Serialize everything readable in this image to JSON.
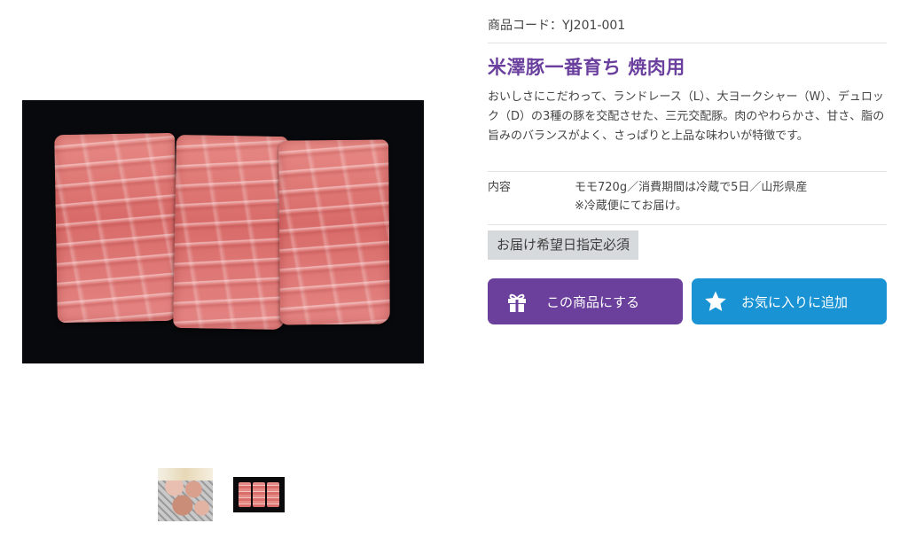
{
  "gallery": {
    "main_image_alt": "",
    "thumbnails": [
      {
        "name": "thumbnail-package"
      },
      {
        "name": "thumbnail-meat"
      }
    ]
  },
  "product": {
    "code": "商品コード：YJ201-001",
    "title": "米澤豚一番育ち 焼肉用",
    "description": "おいしさにこだわって、ランドレース（L）、大ヨークシャー（W）、デュロック（D）の3種の豚を交配させた、三元交配豚。肉のやわらかさ、甘さ、脂の旨みのバランスがよく、さっぱりと上品な味わいが特徴です。",
    "spec": {
      "label": "内容",
      "value_line1": "モモ720g／消費期間は冷蔵で5日／山形県産",
      "value_line2": "※冷蔵便にてお届け。"
    },
    "badge": "お届け希望日指定必須"
  },
  "actions": {
    "select_label": "この商品にする",
    "select_icon": "gift-icon",
    "favorite_label": "お気に入りに追加",
    "favorite_icon": "star-icon"
  },
  "colors": {
    "title": "#6a3f9e",
    "select_button": "#6b3f9c",
    "favorite_button": "#1a93d4",
    "badge_bg": "#d6dadd"
  }
}
